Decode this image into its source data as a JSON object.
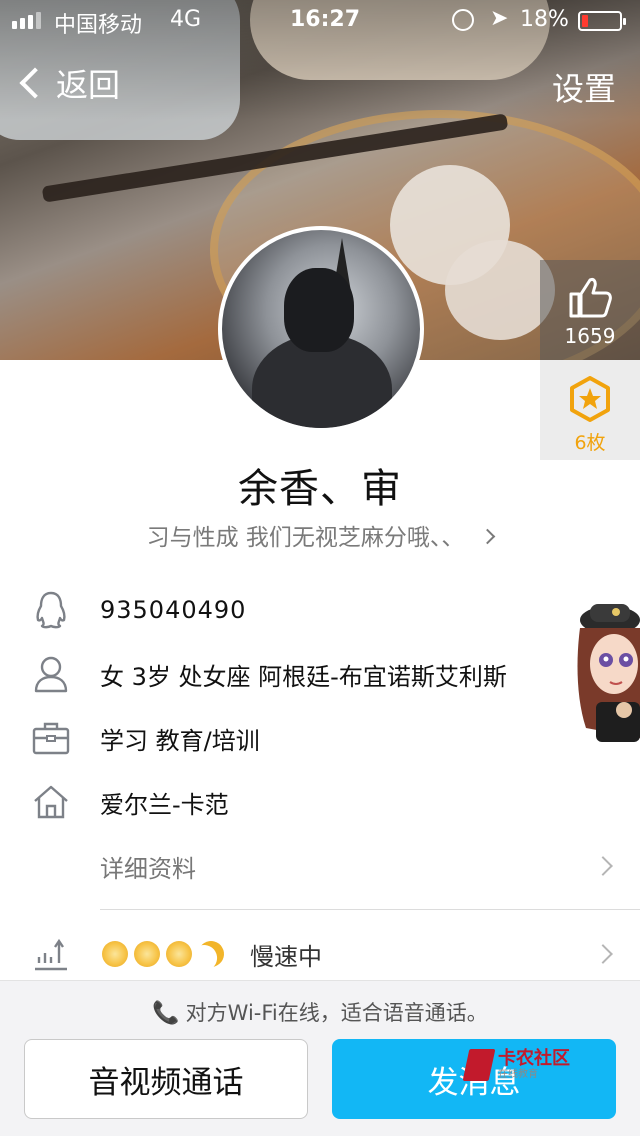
{
  "status_bar": {
    "carrier": "中国移动",
    "network": "4G",
    "time": "16:27",
    "battery_text": "18%",
    "battery_level": 0.18,
    "battery_color": "#ff3b30"
  },
  "nav": {
    "back_label": "返回",
    "settings_label": "设置"
  },
  "like": {
    "count": "1659",
    "icon": "thumbs-up-icon"
  },
  "medal": {
    "count": "6枚",
    "icon": "star-medal-icon",
    "color": "#f1a30d"
  },
  "profile": {
    "name": "余香、审",
    "signature": "习与性成  我们无视芝麻分哦、、"
  },
  "info": {
    "qq_number": "935040490",
    "personal": "女  3岁  处女座  阿根廷-布宜诺斯艾利斯",
    "career": "学习  教育/培训",
    "hometown": "爱尔兰-卡范",
    "details_label": "详细资料",
    "level_status": "慢速中",
    "level_suns": 3,
    "level_moons": 1
  },
  "bottom": {
    "wifi_tip": "对方Wi-Fi在线，适合语音通话。",
    "call_button": "音视频通话",
    "message_button": "发消息",
    "accent": "#12b7f5"
  },
  "watermark": {
    "title": "卡农社区",
    "subtitle": "在线教育"
  }
}
